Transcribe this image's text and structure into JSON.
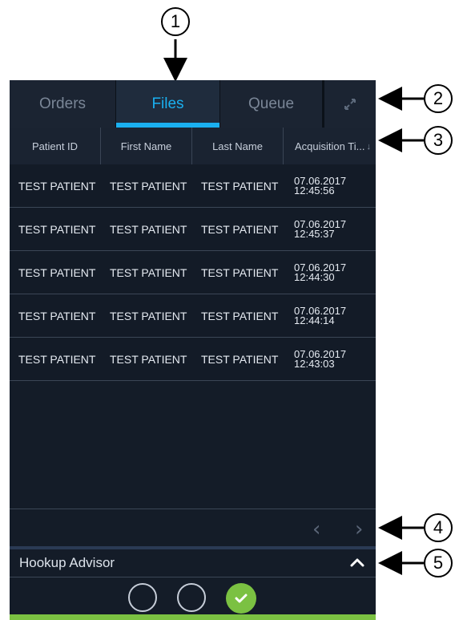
{
  "callouts": [
    "1",
    "2",
    "3",
    "4",
    "5"
  ],
  "tabs": [
    {
      "label": "Orders",
      "active": false
    },
    {
      "label": "Files",
      "active": true
    },
    {
      "label": "Queue",
      "active": false
    }
  ],
  "expand_icon": "expand-icon",
  "table": {
    "columns": [
      "Patient ID",
      "First Name",
      "Last Name",
      "Acquisition Ti..."
    ],
    "rows": [
      {
        "patient_id": "TEST PATIENT",
        "first_name": "TEST PATIENT",
        "last_name": "TEST PATIENT",
        "date": "07.06.2017",
        "time": "12:45:56"
      },
      {
        "patient_id": "TEST PATIENT",
        "first_name": "TEST PATIENT",
        "last_name": "TEST PATIENT",
        "date": "07.06.2017",
        "time": "12:45:37"
      },
      {
        "patient_id": "TEST PATIENT",
        "first_name": "TEST PATIENT",
        "last_name": "TEST PATIENT",
        "date": "07.06.2017",
        "time": "12:44:30"
      },
      {
        "patient_id": "TEST PATIENT",
        "first_name": "TEST PATIENT",
        "last_name": "TEST PATIENT",
        "date": "07.06.2017",
        "time": "12:44:14"
      },
      {
        "patient_id": "TEST PATIENT",
        "first_name": "TEST PATIENT",
        "last_name": "TEST PATIENT",
        "date": "07.06.2017",
        "time": "12:43:03"
      }
    ]
  },
  "pager": {
    "prev": "‹",
    "next": "›"
  },
  "hookup": {
    "title": "Hookup Advisor"
  },
  "colors": {
    "accent": "#1ab0f0",
    "panel": "#141c28",
    "ok_green": "#7bc142"
  }
}
